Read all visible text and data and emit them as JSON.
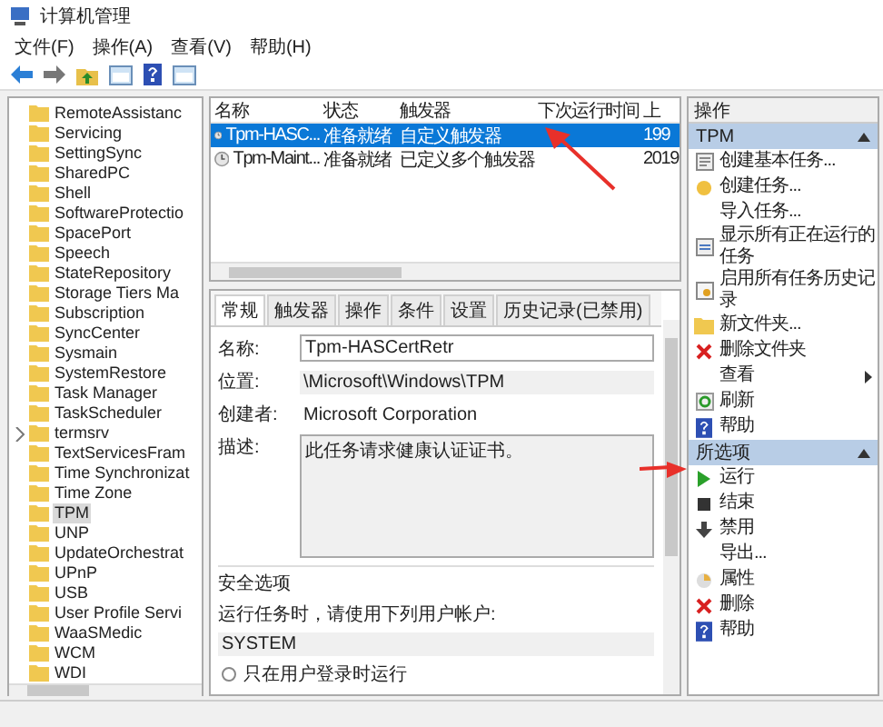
{
  "window": {
    "title": "计算机管理"
  },
  "menu": [
    "文件(F)",
    "操作(A)",
    "查看(V)",
    "帮助(H)"
  ],
  "tree": {
    "items": [
      {
        "label": "RemoteAssistanc",
        "selected": false,
        "expandable": false
      },
      {
        "label": "Servicing",
        "selected": false,
        "expandable": false
      },
      {
        "label": "SettingSync",
        "selected": false,
        "expandable": false
      },
      {
        "label": "SharedPC",
        "selected": false,
        "expandable": false
      },
      {
        "label": "Shell",
        "selected": false,
        "expandable": false
      },
      {
        "label": "SoftwareProtectio",
        "selected": false,
        "expandable": false
      },
      {
        "label": "SpacePort",
        "selected": false,
        "expandable": false
      },
      {
        "label": "Speech",
        "selected": false,
        "expandable": false
      },
      {
        "label": "StateRepository",
        "selected": false,
        "expandable": false
      },
      {
        "label": "Storage Tiers Ma",
        "selected": false,
        "expandable": false
      },
      {
        "label": "Subscription",
        "selected": false,
        "expandable": false
      },
      {
        "label": "SyncCenter",
        "selected": false,
        "expandable": false
      },
      {
        "label": "Sysmain",
        "selected": false,
        "expandable": false
      },
      {
        "label": "SystemRestore",
        "selected": false,
        "expandable": false
      },
      {
        "label": "Task Manager",
        "selected": false,
        "expandable": false
      },
      {
        "label": "TaskScheduler",
        "selected": false,
        "expandable": false
      },
      {
        "label": "termsrv",
        "selected": false,
        "expandable": true
      },
      {
        "label": "TextServicesFram",
        "selected": false,
        "expandable": false
      },
      {
        "label": "Time Synchronizat",
        "selected": false,
        "expandable": false
      },
      {
        "label": "Time Zone",
        "selected": false,
        "expandable": false
      },
      {
        "label": "TPM",
        "selected": true,
        "expandable": false
      },
      {
        "label": "UNP",
        "selected": false,
        "expandable": false
      },
      {
        "label": "UpdateOrchestrat",
        "selected": false,
        "expandable": false
      },
      {
        "label": "UPnP",
        "selected": false,
        "expandable": false
      },
      {
        "label": "USB",
        "selected": false,
        "expandable": false
      },
      {
        "label": "User Profile Servi",
        "selected": false,
        "expandable": false
      },
      {
        "label": "WaaSMedic",
        "selected": false,
        "expandable": false
      },
      {
        "label": "WCM",
        "selected": false,
        "expandable": false
      },
      {
        "label": "WDI",
        "selected": false,
        "expandable": false
      }
    ]
  },
  "task_list": {
    "columns": [
      "名称",
      "状态",
      "触发器",
      "下次运行时间",
      "上"
    ],
    "rows": [
      {
        "cells": [
          "Tpm-HASC...",
          "准备就绪",
          "自定义触发器",
          "",
          "199"
        ],
        "selected": true
      },
      {
        "cells": [
          "Tpm-Maint...",
          "准备就绪",
          "已定义多个触发器",
          "",
          "2019"
        ],
        "selected": false
      }
    ]
  },
  "details": {
    "tabs": [
      {
        "label": "常规",
        "selected": true
      },
      {
        "label": "触发器",
        "selected": false
      },
      {
        "label": "操作",
        "selected": false
      },
      {
        "label": "条件",
        "selected": false
      },
      {
        "label": "设置",
        "selected": false
      },
      {
        "label": "历史记录(已禁用)",
        "selected": false
      }
    ],
    "name_label": "名称:",
    "name": "Tpm-HASCertRetr",
    "location_label": "位置:",
    "location": "\\Microsoft\\Windows\\TPM",
    "author_label": "创建者:",
    "author": "Microsoft Corporation",
    "description_label": "描述:",
    "description": "此任务请求健康认证证书。",
    "security": {
      "title": "安全选项",
      "prompt": "运行任务时，请使用下列用户帐户:",
      "account": "SYSTEM",
      "options": [
        {
          "label": "只在用户登录时运行",
          "selected": false
        }
      ]
    }
  },
  "actions": {
    "title": "操作",
    "sections": [
      {
        "title": "TPM",
        "expanded": true,
        "items": [
          {
            "label": "创建基本任务...",
            "kind": "task"
          },
          {
            "label": "创建任务...",
            "kind": "newtask"
          },
          {
            "label": "导入任务...",
            "kind": "plain"
          },
          {
            "label": "显示所有正在运行的任务",
            "kind": "list"
          },
          {
            "label": "启用所有任务历史记录",
            "kind": "history"
          },
          {
            "label": "新文件夹...",
            "kind": "folder"
          },
          {
            "label": "删除文件夹",
            "kind": "delete"
          },
          {
            "label": "查看",
            "kind": "submenu"
          },
          {
            "label": "刷新",
            "kind": "refresh"
          },
          {
            "label": "帮助",
            "kind": "help"
          }
        ]
      },
      {
        "title": "所选项",
        "expanded": true,
        "items": [
          {
            "label": "运行",
            "kind": "run"
          },
          {
            "label": "结束",
            "kind": "stop"
          },
          {
            "label": "禁用",
            "kind": "disable"
          },
          {
            "label": "导出...",
            "kind": "plain"
          },
          {
            "label": "属性",
            "kind": "properties"
          },
          {
            "label": "删除",
            "kind": "delete"
          },
          {
            "label": "帮助",
            "kind": "help"
          }
        ]
      }
    ]
  }
}
